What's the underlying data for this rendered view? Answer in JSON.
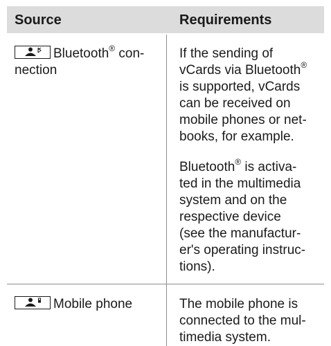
{
  "table": {
    "headers": {
      "source": "Source",
      "requirements": "Requirements"
    },
    "rows": [
      {
        "source_pre": "Bluetooth",
        "source_sup": "®",
        "source_post": " con-",
        "source_line2": "nection",
        "icon": "person-bluetooth-icon",
        "req_p1": [
          {
            "pre": "If the sending of",
            "sup": "",
            "post": ""
          },
          {
            "pre": "vCards via Bluetooth",
            "sup": "®",
            "post": ""
          },
          {
            "pre": "is supported, vCards",
            "sup": "",
            "post": ""
          },
          {
            "pre": "can be received on",
            "sup": "",
            "post": ""
          },
          {
            "pre": "mobile phones or net-",
            "sup": "",
            "post": ""
          },
          {
            "pre": "books, for example.",
            "sup": "",
            "post": ""
          }
        ],
        "req_p2": [
          {
            "pre": "Bluetooth",
            "sup": "®",
            "post": " is activa-"
          },
          {
            "pre": "ted in the multimedia",
            "sup": "",
            "post": ""
          },
          {
            "pre": "system and on the",
            "sup": "",
            "post": ""
          },
          {
            "pre": "respective device",
            "sup": "",
            "post": ""
          },
          {
            "pre": "(see the manufactur-",
            "sup": "",
            "post": ""
          },
          {
            "pre": "er's operating instruc-",
            "sup": "",
            "post": ""
          },
          {
            "pre": "tions).",
            "sup": "",
            "post": ""
          }
        ]
      },
      {
        "source_pre": "Mobile phone",
        "icon": "person-phone-icon",
        "req_p1": [
          {
            "pre": "The mobile phone is",
            "sup": "",
            "post": ""
          },
          {
            "pre": "connected to the mul-",
            "sup": "",
            "post": ""
          },
          {
            "pre": "timedia system.",
            "sup": "",
            "post": ""
          }
        ]
      }
    ]
  },
  "colors": {
    "header_bg": "#dcdcdc",
    "rule": "#8c8c8c",
    "text": "#1a1a1a"
  }
}
